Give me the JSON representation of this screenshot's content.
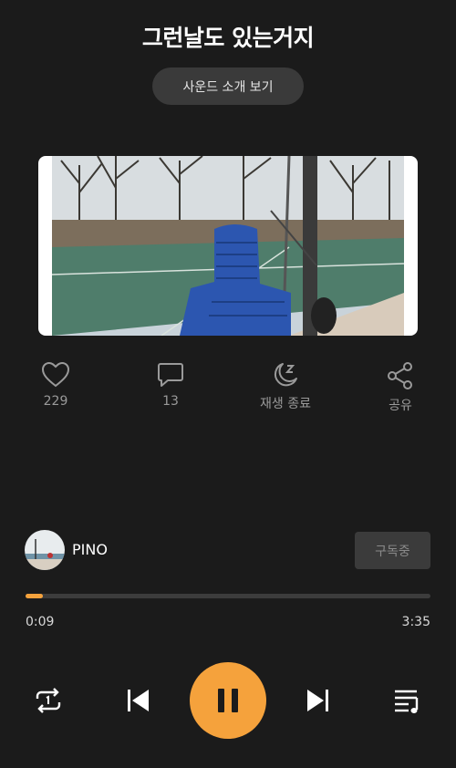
{
  "track": {
    "title": "그런날도 있는거지",
    "intro_button": "사운드 소개 보기"
  },
  "actions": {
    "like": {
      "icon": "heart-icon",
      "label": "229"
    },
    "comment": {
      "icon": "comment-icon",
      "label": "13"
    },
    "sleep_timer": {
      "icon": "moon-sleep-icon",
      "label": "재생 종료"
    },
    "share": {
      "icon": "share-icon",
      "label": "공유"
    }
  },
  "artist": {
    "name": "PINO",
    "subscribe_label": "구독중"
  },
  "player": {
    "current_time": "0:09",
    "total_time": "3:35",
    "progress_fraction": 0.042,
    "state": "playing",
    "accent_color": "#f5a23c",
    "controls": [
      "repeat-one-icon",
      "previous-icon",
      "pause-icon",
      "next-icon",
      "playlist-icon"
    ]
  }
}
